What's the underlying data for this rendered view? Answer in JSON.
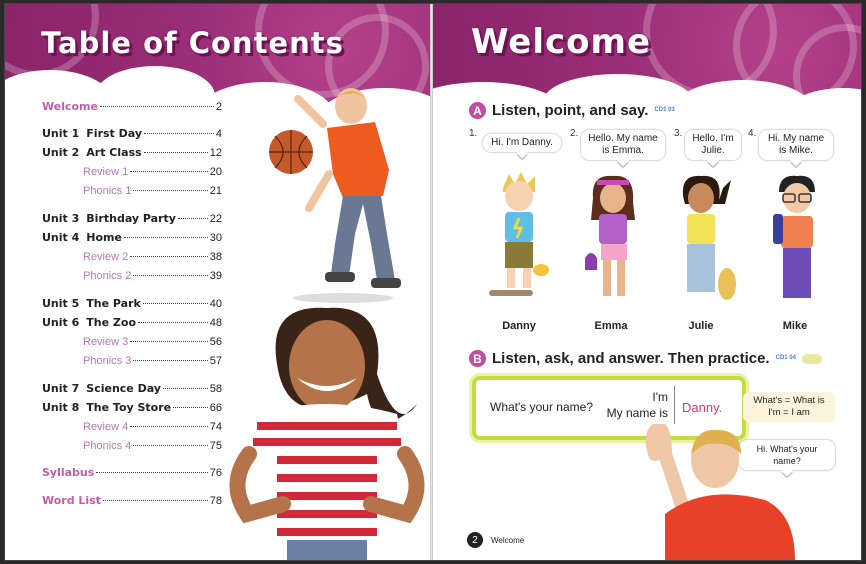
{
  "left_page": {
    "title": "Table of Contents",
    "entries": [
      {
        "type": "pink",
        "label": "Welcome",
        "page": "2"
      },
      {
        "type": "unit",
        "unit": "Unit 1",
        "name": "First Day",
        "page": "4"
      },
      {
        "type": "unit",
        "unit": "Unit 2",
        "name": "Art Class",
        "page": "12"
      },
      {
        "type": "sub",
        "name": "Review 1",
        "page": "20"
      },
      {
        "type": "sub",
        "name": "Phonics 1",
        "page": "21"
      },
      {
        "type": "unit",
        "unit": "Unit 3",
        "name": "Birthday Party",
        "page": "22"
      },
      {
        "type": "unit",
        "unit": "Unit 4",
        "name": "Home",
        "page": "30"
      },
      {
        "type": "sub",
        "name": "Review 2",
        "page": "38"
      },
      {
        "type": "sub",
        "name": "Phonics 2",
        "page": "39"
      },
      {
        "type": "unit",
        "unit": "Unit 5",
        "name": "The Park",
        "page": "40"
      },
      {
        "type": "unit",
        "unit": "Unit 6",
        "name": "The Zoo",
        "page": "48"
      },
      {
        "type": "sub",
        "name": "Review 3",
        "page": "56"
      },
      {
        "type": "sub",
        "name": "Phonics 3",
        "page": "57"
      },
      {
        "type": "unit",
        "unit": "Unit 7",
        "name": "Science Day",
        "page": "58"
      },
      {
        "type": "unit",
        "unit": "Unit 8",
        "name": "The Toy Store",
        "page": "66"
      },
      {
        "type": "sub",
        "name": "Review 4",
        "page": "74"
      },
      {
        "type": "sub",
        "name": "Phonics 4",
        "page": "75"
      },
      {
        "type": "pink",
        "label": "Syllabus",
        "page": "76"
      },
      {
        "type": "pink",
        "label": "Word List",
        "page": "78"
      }
    ]
  },
  "right_page": {
    "title": "Welcome",
    "section_a": {
      "letter": "A",
      "heading": "Listen, point, and say.",
      "audio_badge": "CD1 03"
    },
    "kids": [
      {
        "num": "1.",
        "speech": "Hi. I'm Danny.",
        "name": "Danny"
      },
      {
        "num": "2.",
        "speech": "Hello. My name is Emma.",
        "name": "Emma"
      },
      {
        "num": "3.",
        "speech": "Hello. I'm Julie.",
        "name": "Julie"
      },
      {
        "num": "4.",
        "speech": "Hi. My name is Mike.",
        "name": "Mike"
      }
    ],
    "section_b": {
      "letter": "B",
      "heading": "Listen, ask, and answer. Then practice.",
      "audio_badge": "CD1 04"
    },
    "practice": {
      "question": "What's your name?",
      "answer_1": "I'm",
      "answer_2": "My name is",
      "name": "Danny."
    },
    "contraction_tip": {
      "line_1": "What's = What is",
      "line_2": "I'm = I am"
    },
    "boy_speech": "Hi. What's your name?",
    "footer": {
      "page_number": "2",
      "label": "Welcome"
    }
  },
  "colors": {
    "magenta": "#9a2e78",
    "pink_text": "#c25ea8",
    "lime": "#c6dc3a",
    "danny_red": "#d8386f"
  }
}
